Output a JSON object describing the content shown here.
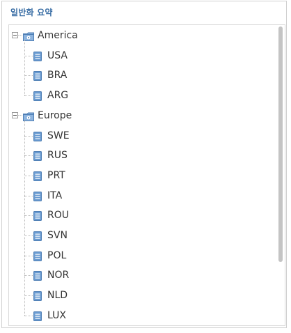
{
  "panel": {
    "title": "일반화 요약"
  },
  "tree": [
    {
      "label": "America",
      "expanded": true,
      "icon": "folder-gear-icon",
      "children": [
        "USA",
        "BRA",
        "ARG"
      ]
    },
    {
      "label": "Europe",
      "expanded": true,
      "icon": "folder-gear-icon",
      "children": [
        "SWE",
        "RUS",
        "PRT",
        "ITA",
        "ROU",
        "SVN",
        "POL",
        "NOR",
        "NLD",
        "LUX"
      ]
    }
  ],
  "colors": {
    "title": "#3a6ea5",
    "icon_blue": "#6a9bd1",
    "border": "#cfcfcf"
  }
}
